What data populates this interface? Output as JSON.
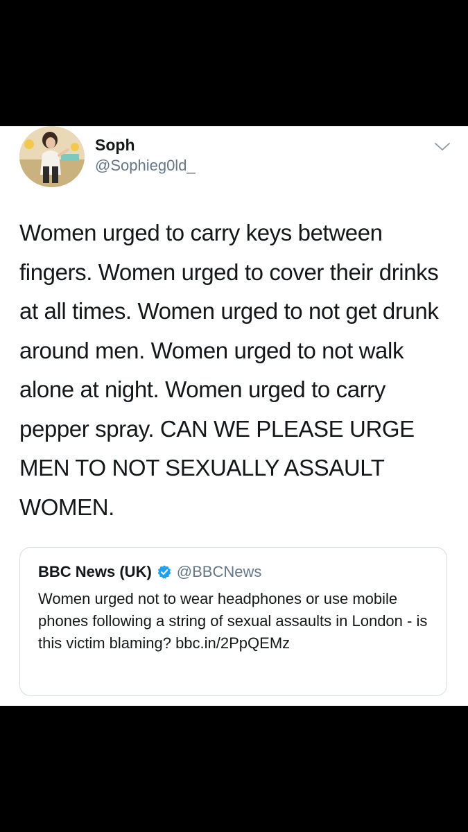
{
  "tweet": {
    "display_name": "Soph",
    "handle": "@Sophieg0ld_",
    "avatar_icon": "profile-photo",
    "menu_icon": "chevron-down-icon",
    "text": "Women urged to carry keys between fingers. Women urged to cover their drinks at all times. Women urged to not get drunk around men. Women urged to not walk alone at night. Women urged to carry pepper spray. CAN WE PLEASE URGE MEN TO NOT SEXUALLY ASSAULT WOMEN."
  },
  "quoted_tweet": {
    "display_name": "BBC News (UK)",
    "handle": "@BBCNews",
    "verified_icon": "verified-badge-icon",
    "text": "Women urged not to wear headphones or use mobile phones following a string of sexual assaults in London - is this victim blaming? bbc.in/2PpQEMz"
  },
  "colors": {
    "text_primary": "#14171a",
    "text_secondary": "#657786",
    "verified_blue": "#1da1f2",
    "border": "#d6dde3",
    "background": "#ffffff",
    "frame": "#000000"
  }
}
